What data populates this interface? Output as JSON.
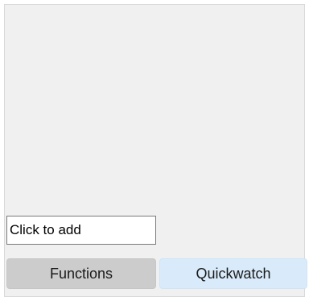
{
  "watch_panel": {
    "input": {
      "value": "Click to add",
      "placeholder": ""
    },
    "tabs": [
      {
        "label": "Functions",
        "selected": false
      },
      {
        "label": "Quickwatch",
        "selected": true
      }
    ],
    "colors": {
      "panel_background": "#f0f0f0",
      "functions_tab": "#cccccc",
      "quickwatch_tab": "#d9ebfa"
    }
  }
}
